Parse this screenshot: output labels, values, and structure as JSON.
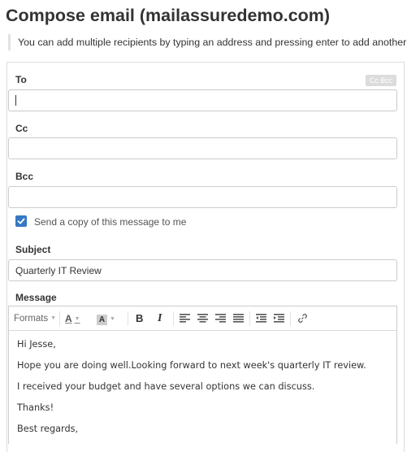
{
  "page": {
    "title": "Compose email (mailassuredemo.com)",
    "hint": "You can add multiple recipients by typing an address and pressing enter to add another one"
  },
  "form": {
    "to_label": "To",
    "to_value": "",
    "cc_bcc_toggle": "Cc Bcc",
    "cc_label": "Cc",
    "cc_value": "",
    "bcc_label": "Bcc",
    "bcc_value": "",
    "send_copy_label": "Send a copy of this message to me",
    "send_copy_checked": true,
    "subject_label": "Subject",
    "subject_value": "Quarterly IT Review",
    "message_label": "Message"
  },
  "toolbar": {
    "formats_label": "Formats",
    "font_color_glyph": "A",
    "bg_color_glyph": "A",
    "bold_glyph": "B",
    "italic_glyph": "I",
    "icons": [
      "align-left-icon",
      "align-center-icon",
      "align-right-icon",
      "align-justify-icon",
      "outdent-icon",
      "indent-icon",
      "link-icon"
    ]
  },
  "message_body": {
    "lines": [
      "Hi Jesse,",
      "Hope you are doing well.Looking forward to next week's quarterly IT review.",
      "I received your budget and have several options we can discuss.",
      "Thanks!",
      "Best regards,"
    ]
  },
  "colors": {
    "accent": "#3578c4",
    "border": "#cccccc",
    "text": "#333333"
  }
}
